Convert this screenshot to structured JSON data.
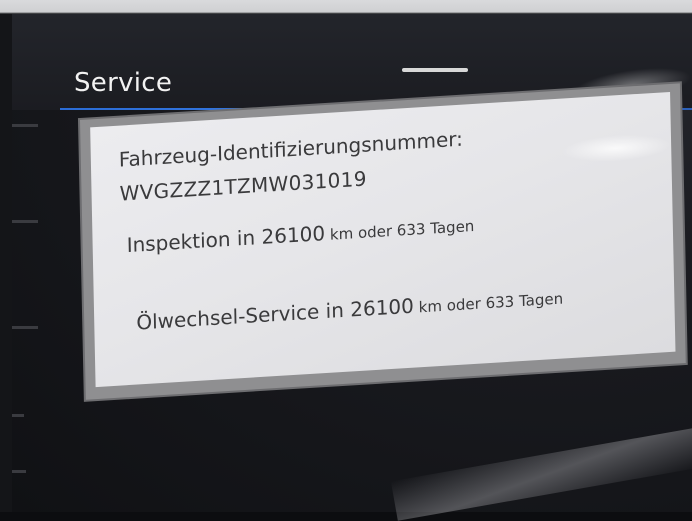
{
  "header": {
    "title": "Service",
    "back_icon": "back-arrow-icon"
  },
  "service_info": {
    "vin_label": "Fahrzeug-Identifizierungsnummer:",
    "vin_value": "WVGZZZ1TZMW031019",
    "inspection": {
      "prefix": "Inspektion in 26100",
      "unit_text": " km oder 633 Tagen"
    },
    "oil_service": {
      "prefix": "Ölwechsel-Service in 26100",
      "unit_text": " km oder 633 Tagen"
    }
  },
  "colors": {
    "accent": "#2b6cd6",
    "panel_background": "#e8e8ea",
    "text": "#3a3a3c"
  }
}
